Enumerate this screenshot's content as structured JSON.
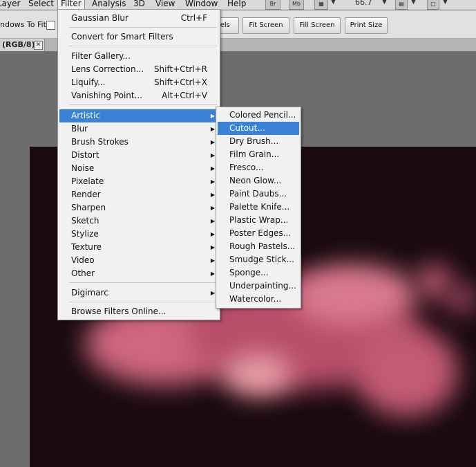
{
  "menubar": {
    "items": [
      "Layer",
      "Select",
      "Filter",
      "Analysis",
      "3D",
      "View",
      "Window",
      "Help"
    ],
    "icons": [
      "Br",
      "Mb"
    ],
    "zoom": "66.7"
  },
  "options": {
    "label": "ndows To Fit",
    "buttons": [
      "xels",
      "Fit Screen",
      "Fill Screen",
      "Print Size"
    ]
  },
  "tab": {
    "label": "(RGB/8)",
    "close": "✕"
  },
  "filter_menu": {
    "items": [
      {
        "label": "Gaussian Blur",
        "shortcut": "Ctrl+F"
      },
      {
        "label": "Convert for Smart Filters",
        "shortcut": ""
      },
      {
        "label": "Filter Gallery...",
        "shortcut": ""
      },
      {
        "label": "Lens Correction...",
        "shortcut": "Shift+Ctrl+R"
      },
      {
        "label": "Liquify...",
        "shortcut": "Shift+Ctrl+X"
      },
      {
        "label": "Vanishing Point...",
        "shortcut": "Alt+Ctrl+V"
      },
      {
        "label": "Artistic",
        "shortcut": ""
      },
      {
        "label": "Blur",
        "shortcut": ""
      },
      {
        "label": "Brush Strokes",
        "shortcut": ""
      },
      {
        "label": "Distort",
        "shortcut": ""
      },
      {
        "label": "Noise",
        "shortcut": ""
      },
      {
        "label": "Pixelate",
        "shortcut": ""
      },
      {
        "label": "Render",
        "shortcut": ""
      },
      {
        "label": "Sharpen",
        "shortcut": ""
      },
      {
        "label": "Sketch",
        "shortcut": ""
      },
      {
        "label": "Stylize",
        "shortcut": ""
      },
      {
        "label": "Texture",
        "shortcut": ""
      },
      {
        "label": "Video",
        "shortcut": ""
      },
      {
        "label": "Other",
        "shortcut": ""
      },
      {
        "label": "Digimarc",
        "shortcut": ""
      },
      {
        "label": "Browse Filters Online...",
        "shortcut": ""
      }
    ]
  },
  "artistic_menu": {
    "items": [
      "Colored Pencil...",
      "Cutout...",
      "Dry Brush...",
      "Film Grain...",
      "Fresco...",
      "Neon Glow...",
      "Paint Daubs...",
      "Palette Knife...",
      "Plastic Wrap...",
      "Poster Edges...",
      "Rough Pastels...",
      "Smudge Stick...",
      "Sponge...",
      "Underpainting...",
      "Watercolor..."
    ]
  },
  "colors": {
    "highlight": "#3a82d6",
    "menu_bg": "#f1f1f1",
    "canvas_bg": "#1a0a10",
    "blob": "#e07a92"
  }
}
